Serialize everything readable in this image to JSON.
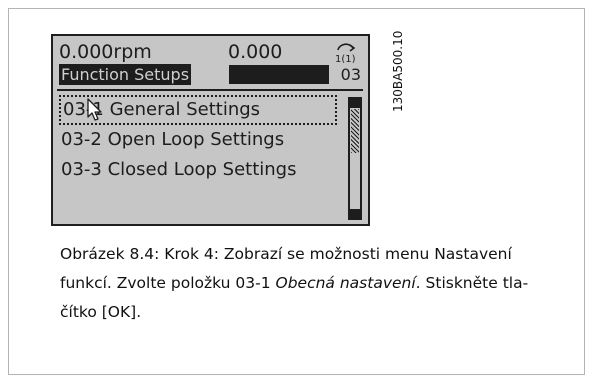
{
  "lcd": {
    "speed": "0.000rpm",
    "value": "0.000",
    "setup_indicator": "1(1)",
    "title": "Function Setups",
    "title_number": "03",
    "menu_items": [
      {
        "label": "03-1 General Settings",
        "selected": true
      },
      {
        "label": "03-2 Open Loop Settings",
        "selected": false
      },
      {
        "label": "03-3 Closed Loop Settings",
        "selected": false
      }
    ],
    "icons": {
      "setup": "setup-indicator-icon",
      "cursor": "mouse-cursor-icon",
      "scroll_up": "scroll-up-arrow-icon",
      "scroll_down": "scroll-down-arrow-icon"
    }
  },
  "figure_id": "130BA500.10",
  "caption": {
    "part1": "Obrázek 8.4: Krok 4: Zobrazí se možnosti menu Nastavení funkcí. Zvolte položku 03-1 ",
    "emphasis": "Obecná nastavení",
    "part2": ". Stiskněte tla-čítko [OK]."
  },
  "colors": {
    "lcd_background": "#c6c6c6",
    "lcd_text": "#1d1d1d",
    "frame": "#b4b4b4"
  }
}
